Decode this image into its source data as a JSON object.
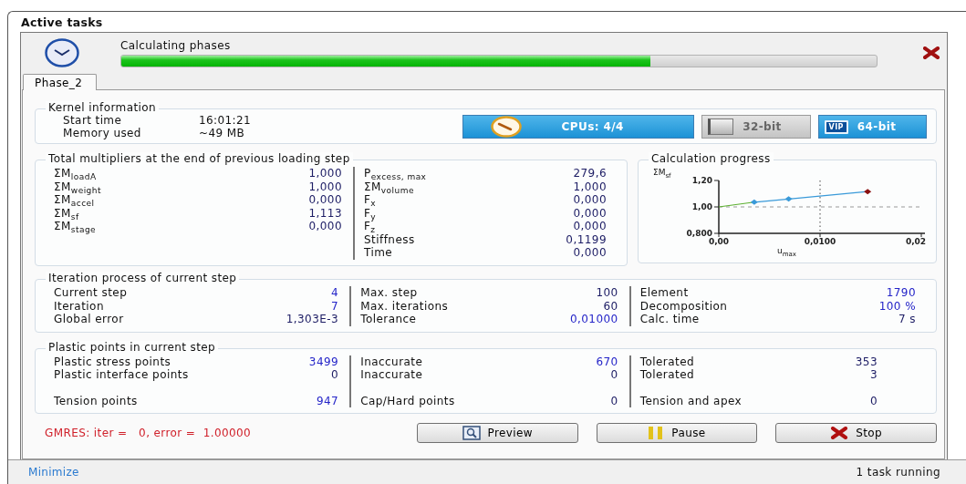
{
  "window": {
    "title": "Active tasks"
  },
  "task": {
    "label": "Calculating phases",
    "level": 0.7
  },
  "tabs": [
    {
      "label": "Phase_2",
      "selected": true
    }
  ],
  "kernel": {
    "title": "Kernel information",
    "rows": [
      {
        "label": "Start time",
        "value": "16:01:21"
      },
      {
        "label": "Memory used",
        "value": "~49 MB"
      }
    ],
    "cpus": "CPUs: 4/4",
    "modes": [
      {
        "label": "32-bit",
        "selected": false
      },
      {
        "label": "64-bit",
        "selected": true,
        "badge": "VIP"
      }
    ]
  },
  "multipliers": {
    "title": "Total multipliers at the end of previous loading step",
    "columns": [
      [
        {
          "label": "ΣM$_{loadA}$",
          "value": "1,000",
          "color": "#1c1c64"
        },
        {
          "label": "ΣM$_{weight}$",
          "value": "1,000",
          "color": "#1c1c64"
        },
        {
          "label": "ΣM$_{accel}$",
          "value": "0,000",
          "color": "#1c1c64"
        },
        {
          "label": "ΣM$_{sf}$",
          "value": "1,113",
          "color": "#1c1c64"
        },
        {
          "label": "ΣM$_{stage}$",
          "value": "0,000",
          "color": "#1c1c64"
        }
      ],
      [
        {
          "label": "P$_{excess, max}$",
          "value": "279,6",
          "color": "#1c1c64"
        },
        {
          "label": "ΣM$_{volume}$",
          "value": "1,000",
          "color": "#1c1c64"
        },
        {
          "label": "F$_{x}$",
          "value": "0,000",
          "color": "#1c1c64"
        },
        {
          "label": "F$_{y}$",
          "value": "0,000",
          "color": "#1c1c64"
        },
        {
          "label": "F$_{z}$",
          "value": "0,000",
          "color": "#1c1c64"
        },
        {
          "label": "Stiffness",
          "value": "0,1199",
          "color": "#1c1c64"
        },
        {
          "label": "Time",
          "value": "0,000",
          "color": "#1c1c64"
        }
      ]
    ]
  },
  "progress_chart": {
    "title": "Calculation progress",
    "chart_data": {
      "type": "line",
      "xlabel": "u$_{max}$",
      "ylabel": "ΣM$_{sf}$",
      "x": [
        0,
        0.0035,
        0.0069,
        0.0147
      ],
      "series": [
        {
          "color": "#5cb030",
          "values": [
            1.0,
            1.036,
            null,
            null
          ]
        },
        {
          "color": "#3a9ad9",
          "marker": "diamond",
          "values": [
            null,
            1.036,
            1.06,
            1.116
          ]
        }
      ],
      "xlim": [
        0,
        0.02
      ],
      "ylim": [
        0.8,
        1.2
      ],
      "xticks": [
        {
          "value": 0,
          "label": "0,00"
        },
        {
          "value": 0.01,
          "label": "0,0100"
        },
        {
          "value": 0.02,
          "label": "0,02"
        }
      ],
      "yticks": [
        {
          "value": 0.8,
          "label": "0,800"
        },
        {
          "value": 1.0,
          "label": "1,00"
        },
        {
          "value": 1.2,
          "label": "1,20"
        }
      ],
      "ref_lines": [
        {
          "axis": "y",
          "value": 1.0
        },
        {
          "axis": "x",
          "value": 0.01
        }
      ]
    }
  },
  "iteration": {
    "title": "Iteration process of current step",
    "columns": [
      [
        {
          "label": "Current step",
          "value": "4",
          "color": "#2424c8"
        },
        {
          "label": "Iteration",
          "value": "7",
          "color": "#2424c8"
        },
        {
          "label": "Global error",
          "value": "1,303E-3",
          "color": "#1c1c64"
        }
      ],
      [
        {
          "label": "Max. step",
          "value": "100",
          "color": "#1c1c64"
        },
        {
          "label": "Max. iterations",
          "value": "60",
          "color": "#1c1c64"
        },
        {
          "label": "Tolerance",
          "value": "0,01000",
          "color": "#2424c8"
        }
      ],
      [
        {
          "label": "Element",
          "value": "1790",
          "color": "#2424c8"
        },
        {
          "label": "Decomposition",
          "value": "100 %",
          "color": "#2424c8"
        },
        {
          "label": "Calc. time",
          "value": "7 s",
          "color": "#1c1c64"
        }
      ]
    ]
  },
  "plastic": {
    "title": "Plastic points in current step",
    "columns": [
      [
        {
          "label": "Plastic stress points",
          "value": "3499",
          "color": "#2424c8"
        },
        {
          "label": "Plastic interface points",
          "value": "0",
          "color": "#1c1c64"
        },
        {
          "label": "Tension points",
          "value": "947",
          "color": "#2424c8",
          "separated": true
        }
      ],
      [
        {
          "label": "Inaccurate",
          "value": "670",
          "color": "#2424c8"
        },
        {
          "label": "Inaccurate",
          "value": "0",
          "color": "#1c1c64"
        },
        {
          "label": "Cap/Hard points",
          "value": "0",
          "color": "#1c1c64",
          "separated": true
        }
      ],
      [
        {
          "label": "Tolerated",
          "value": "353",
          "color": "#1c1c64"
        },
        {
          "label": "Tolerated",
          "value": "3",
          "color": "#1c1c64"
        },
        {
          "label": "Tension and apex",
          "value": "0",
          "color": "#1c1c64",
          "separated": true
        }
      ]
    ]
  },
  "solver_message": "GMRES: iter =   0, error =  1.00000",
  "buttons": [
    {
      "label": "Preview",
      "kind": "preview"
    },
    {
      "label": "Pause",
      "kind": "pause"
    },
    {
      "label": "Stop",
      "kind": "stop"
    }
  ],
  "status_bar": {
    "link": "Minimize",
    "text": "1 task running"
  }
}
